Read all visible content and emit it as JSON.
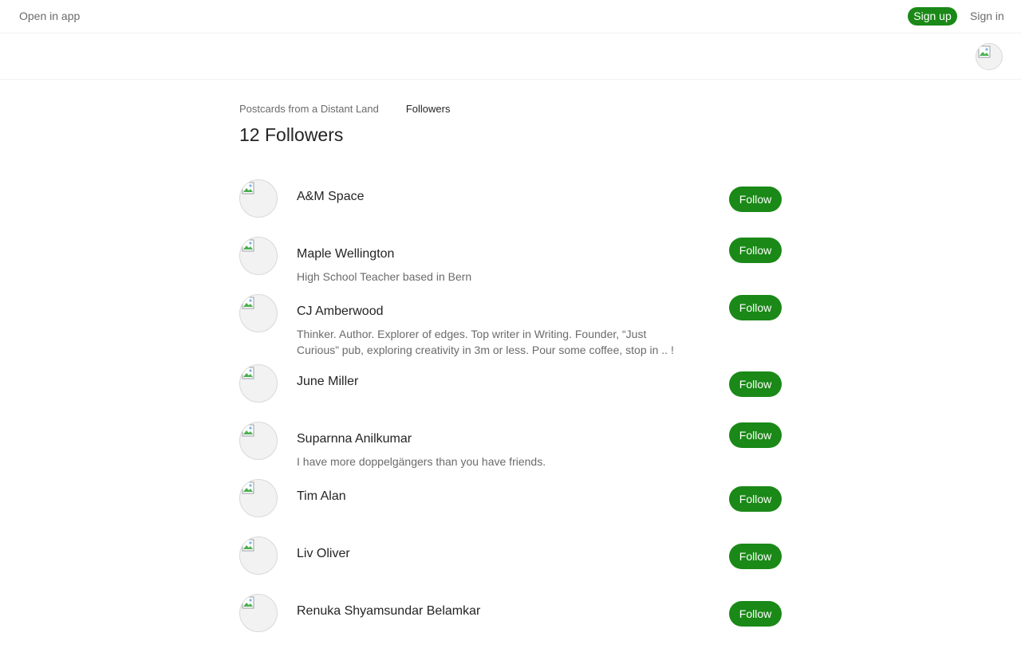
{
  "topbar": {
    "open_in_app": "Open in app",
    "sign_up": "Sign up",
    "sign_in": "Sign in"
  },
  "breadcrumb": {
    "publication": "Postcards from a Distant Land",
    "current": "Followers"
  },
  "page_title": "12 Followers",
  "follow_label": "Follow",
  "colors": {
    "accent": "#1a8917",
    "text_primary": "#242424",
    "text_secondary": "#6b6b6b"
  },
  "followers": [
    {
      "name": "A&M Space",
      "bio": ""
    },
    {
      "name": "Maple Wellington",
      "bio": "High School Teacher based in Bern"
    },
    {
      "name": "CJ Amberwood",
      "bio": "Thinker. Author. Explorer of edges. Top writer in Writing. Founder, “Just Curious” pub, exploring creativity in 3m or less. Pour some coffee, stop in .. !"
    },
    {
      "name": "June Miller",
      "bio": ""
    },
    {
      "name": "Suparnna Anilkumar",
      "bio": "I have more doppelgängers than you have friends."
    },
    {
      "name": "Tim Alan",
      "bio": ""
    },
    {
      "name": "Liv Oliver",
      "bio": ""
    },
    {
      "name": "Renuka Shyamsundar Belamkar",
      "bio": ""
    }
  ]
}
